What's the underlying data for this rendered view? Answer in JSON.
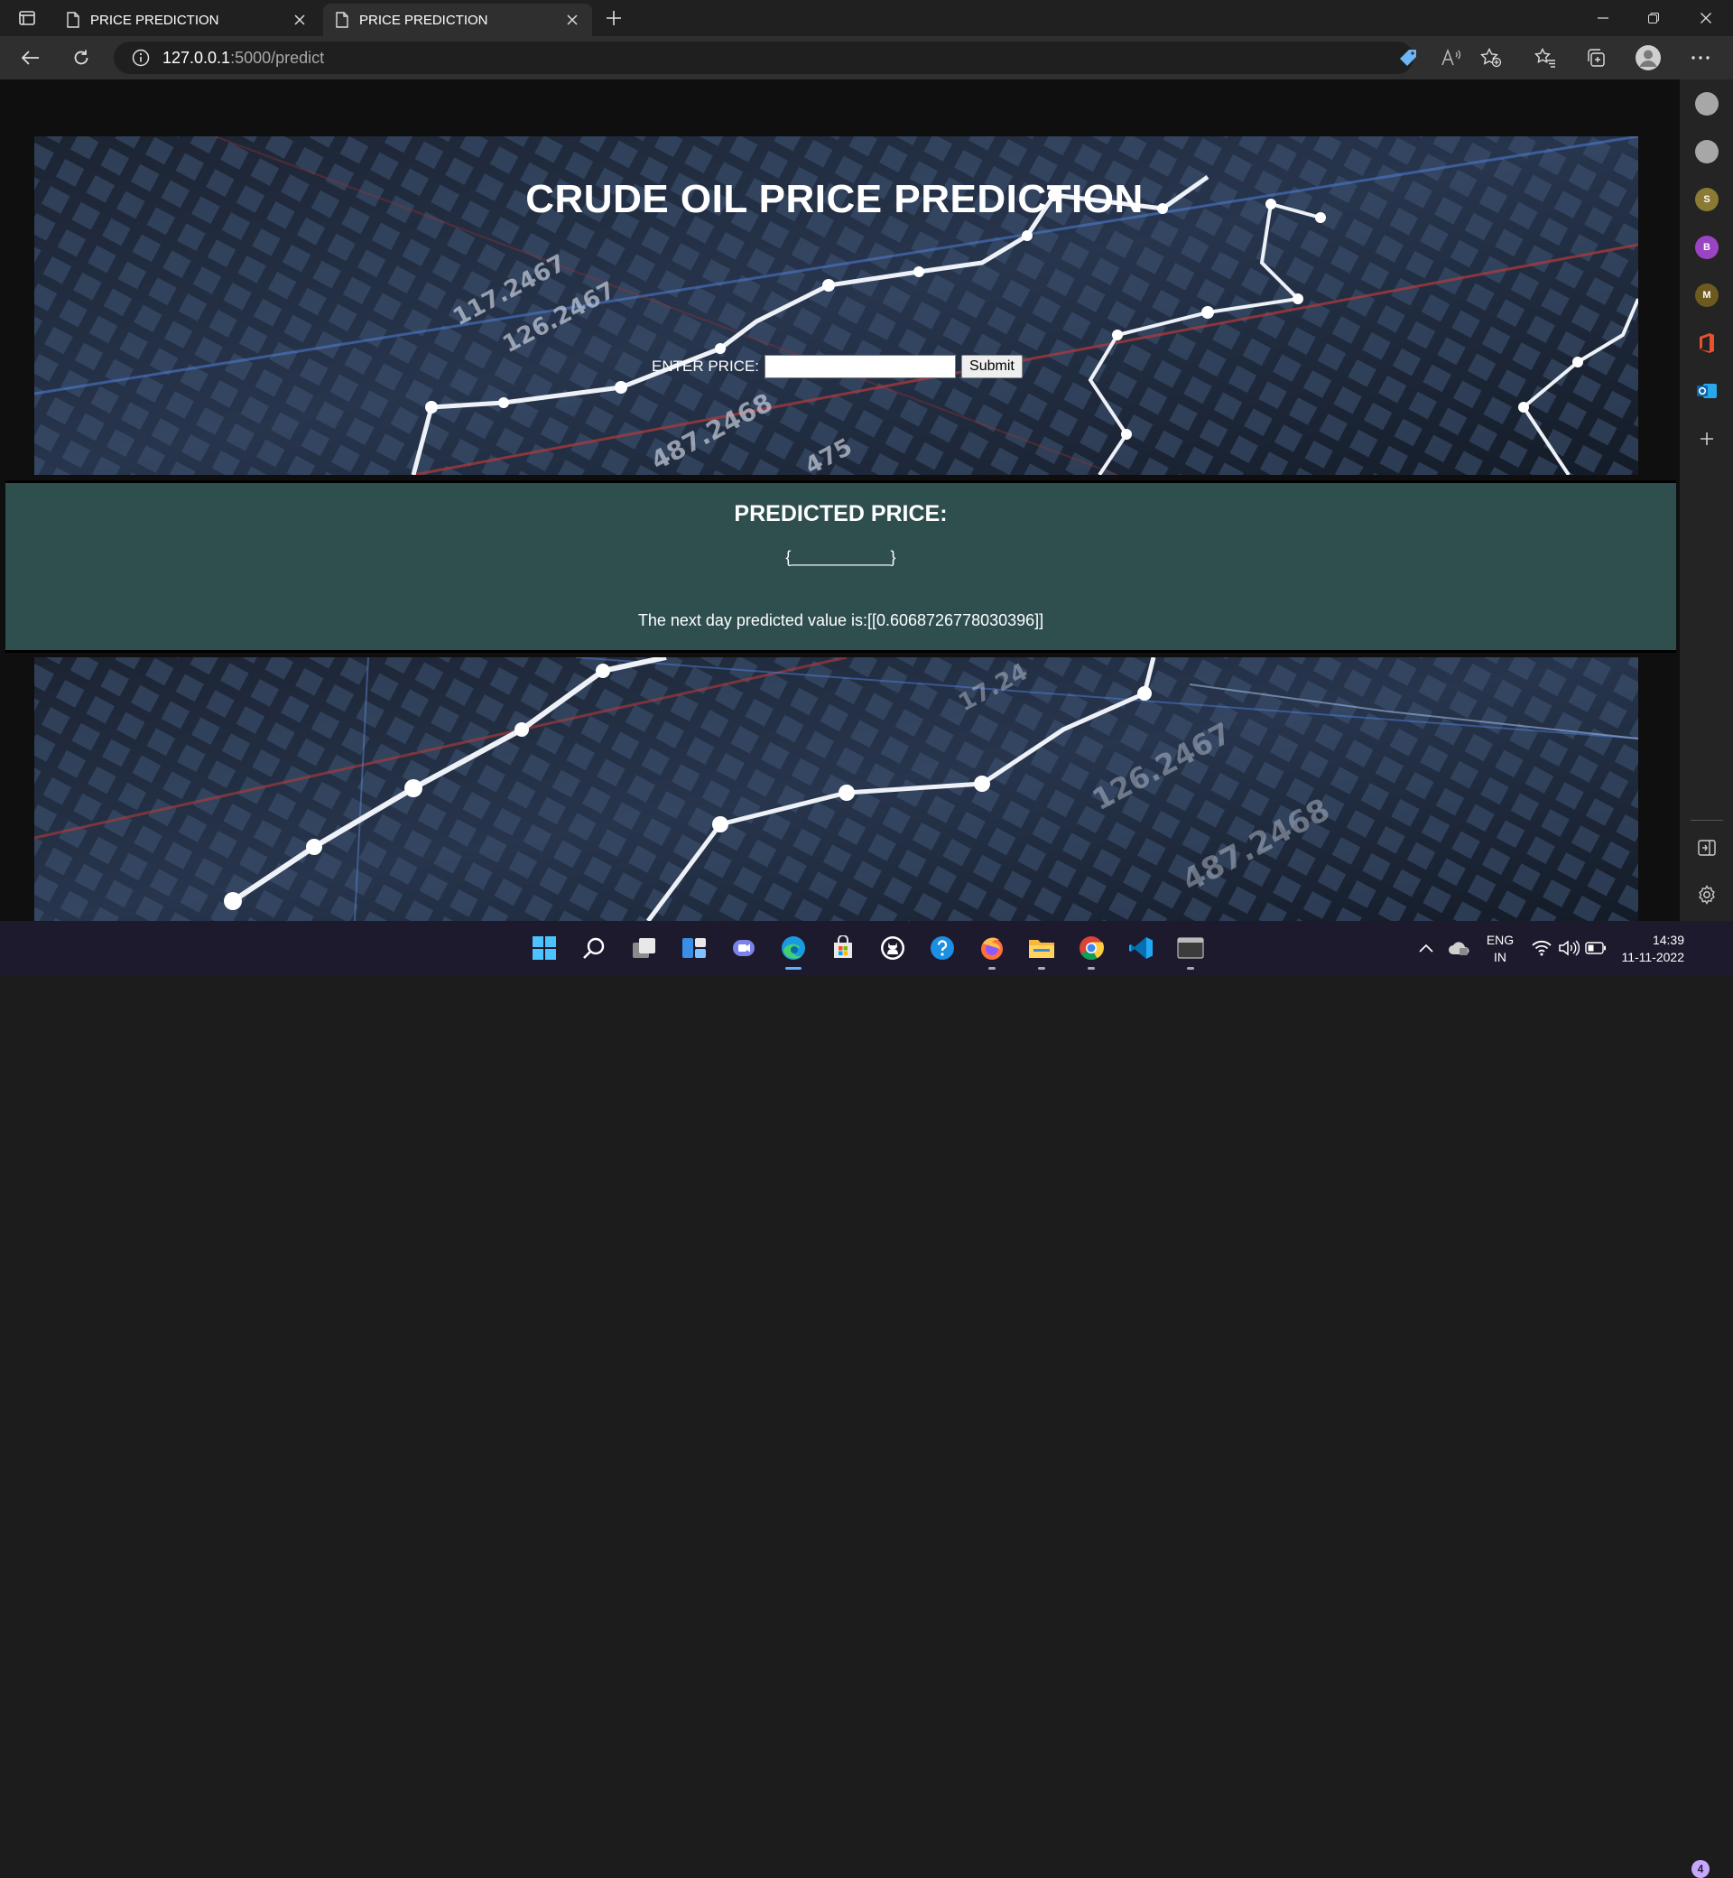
{
  "browser": {
    "tabs": [
      {
        "title": "PRICE PREDICTION",
        "active": false
      },
      {
        "title": "PRICE PREDICTION",
        "active": true
      }
    ],
    "url_host": "127.0.0.1",
    "url_path": ":5000/predict"
  },
  "page": {
    "title": "CRUDE OIL PRICE PREDICTION",
    "price_label": "ENTER PRICE:",
    "price_value": "",
    "submit_label": "Submit",
    "result_heading": "PREDICTED PRICE:",
    "result_braces": "{___________}",
    "result_text": "The next day predicted value is:[[0.6068726778030396]]"
  },
  "sidebar": {
    "items": [
      {
        "icon": "profile-grey-icon",
        "label": ""
      },
      {
        "icon": "profile-grey-icon",
        "label": ""
      },
      {
        "icon": "profile-s-icon",
        "label": "S",
        "color": "#8a7a34"
      },
      {
        "icon": "profile-b-icon",
        "label": "B",
        "color": "#9a44c4"
      },
      {
        "icon": "profile-m-icon",
        "label": "M",
        "color": "#6d5a1f"
      },
      {
        "icon": "office-icon"
      },
      {
        "icon": "outlook-icon"
      },
      {
        "icon": "add-icon"
      }
    ]
  },
  "taskbar": {
    "lang_top": "ENG",
    "lang_bottom": "IN",
    "time": "14:39",
    "date": "11-11-2022",
    "notification_count": "4"
  },
  "colors": {
    "result_bg": "#2f4f4f",
    "tabbar_bg": "#202020",
    "taskbar_bg": "#1e1a2e",
    "accent": "#5fb3f9"
  }
}
